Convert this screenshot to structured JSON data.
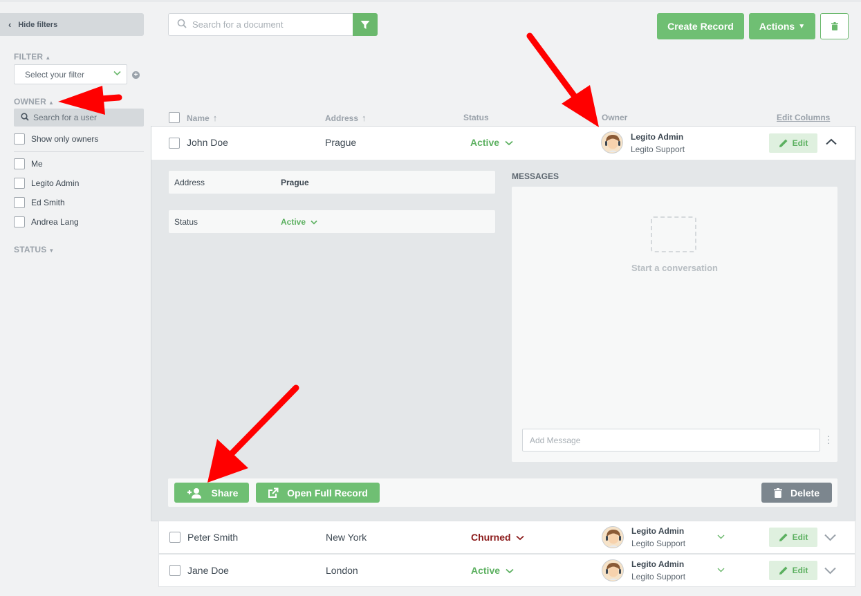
{
  "sidebar": {
    "hide_filters": "Hide filters",
    "filter_label": "FILTER",
    "filter_select_placeholder": "Select your filter",
    "owner_label": "OWNER",
    "owner_search_placeholder": "Search for a user",
    "show_only_owners": "Show only owners",
    "owners": [
      "Me",
      "Legito Admin",
      "Ed Smith",
      "Andrea Lang"
    ],
    "status_label": "STATUS"
  },
  "toolbar": {
    "search_placeholder": "Search for a document",
    "create_record": "Create Record",
    "actions": "Actions"
  },
  "table": {
    "headers": {
      "name": "Name",
      "address": "Address",
      "status": "Status",
      "owner": "Owner"
    },
    "edit_columns": "Edit Columns",
    "edit_label": "Edit",
    "rows": [
      {
        "name": "John Doe",
        "address": "Prague",
        "status": "Active",
        "owner_name": "Legito Admin",
        "owner_sub": "Legito Support"
      },
      {
        "name": "Peter Smith",
        "address": "New York",
        "status": "Churned",
        "owner_name": "Legito Admin",
        "owner_sub": "Legito Support"
      },
      {
        "name": "Jane Doe",
        "address": "London",
        "status": "Active",
        "owner_name": "Legito Admin",
        "owner_sub": "Legito Support"
      }
    ]
  },
  "detail": {
    "fields": [
      {
        "label": "Address",
        "value": "Prague"
      },
      {
        "label": "Status",
        "value": "Active"
      }
    ],
    "messages_title": "MESSAGES",
    "start_conversation": "Start a conversation",
    "add_message_placeholder": "Add Message",
    "share": "Share",
    "open_full_record": "Open Full Record",
    "delete": "Delete"
  },
  "colors": {
    "accent_green": "#6fbf73",
    "active_status": "#5cb060",
    "churned_status": "#8b1a1a",
    "annotation_arrow": "#ff0000"
  }
}
